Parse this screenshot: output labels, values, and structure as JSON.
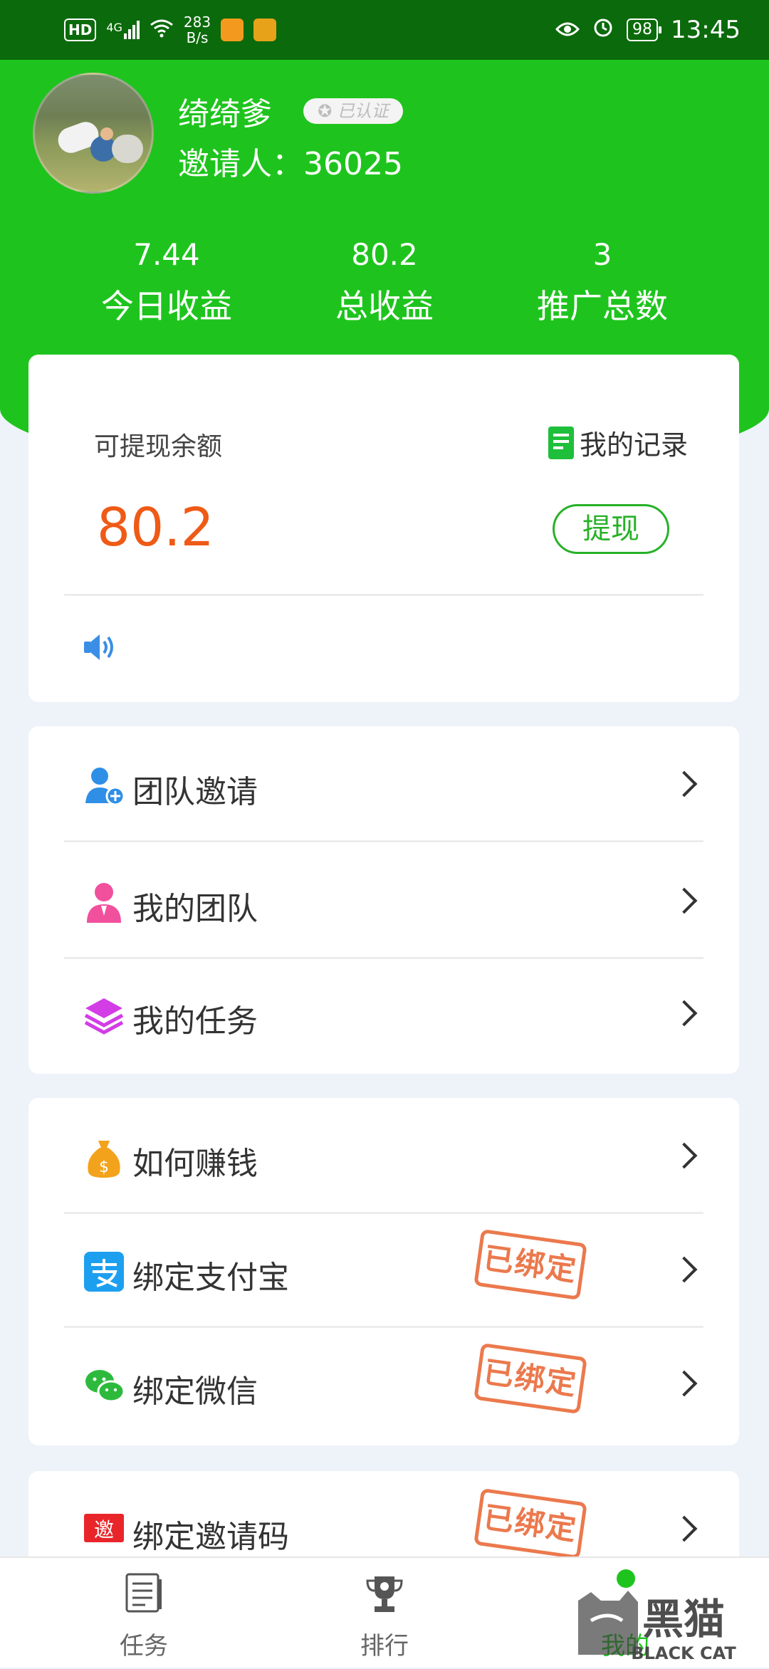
{
  "status_bar": {
    "network_badge": "HD",
    "signal_label": "4G",
    "net_speed_value": "283",
    "net_speed_unit": "B/s",
    "battery": "98",
    "time": "13:45"
  },
  "profile": {
    "name": "绮绮爹",
    "verified_badge": "已认证",
    "inviter_label": "邀请人：",
    "inviter_id": "36025"
  },
  "stats": [
    {
      "value": "7.44",
      "label": "今日收益"
    },
    {
      "value": "80.2",
      "label": "总收益"
    },
    {
      "value": "3",
      "label": "推广总数"
    }
  ],
  "balance": {
    "label": "可提现余额",
    "value": "80.2",
    "record_link": "我的记录",
    "withdraw_button": "提现"
  },
  "menu_group_1": [
    {
      "label": "团队邀请",
      "icon": "add-user-icon"
    },
    {
      "label": "我的团队",
      "icon": "team-member-icon"
    },
    {
      "label": "我的任务",
      "icon": "layers-icon"
    }
  ],
  "menu_group_2": [
    {
      "label": "如何赚钱",
      "icon": "money-bag-icon"
    },
    {
      "label": "绑定支付宝",
      "icon": "alipay-icon",
      "stamp": "已绑定"
    },
    {
      "label": "绑定微信",
      "icon": "wechat-icon",
      "stamp": "已绑定"
    }
  ],
  "menu_group_3": [
    {
      "label": "绑定邀请码",
      "icon": "invite-code-icon",
      "stamp": "已绑定",
      "icon_text": "邀"
    }
  ],
  "bottom_nav": [
    {
      "label": "任务",
      "icon": "task-list-icon"
    },
    {
      "label": "排行",
      "icon": "trophy-icon"
    },
    {
      "label": "我的",
      "icon": "profile-icon",
      "active": true
    }
  ],
  "watermark": {
    "text": "黑猫",
    "subtext": "BLACK CAT"
  },
  "colors": {
    "header_green": "#1ec41d",
    "status_bar_green": "#0b6a0b",
    "balance_orange": "#ef5a16",
    "stamp_red": "#e8622e"
  }
}
